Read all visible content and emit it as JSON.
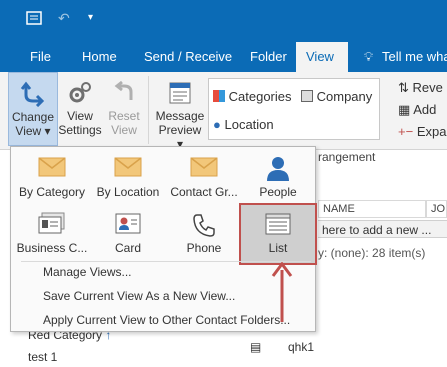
{
  "quick_access": {
    "app_icon": "outlook-icon",
    "undo_icon": "undo-icon",
    "customize_icon": "customize-qat-icon"
  },
  "tabs": [
    {
      "label": "File"
    },
    {
      "label": "Home"
    },
    {
      "label": "Send / Receive"
    },
    {
      "label": "Folder"
    },
    {
      "label": "View"
    },
    {
      "label": "Tell me wha"
    }
  ],
  "ribbon": {
    "change_view": "Change",
    "change_view_2": "View",
    "view_settings": "View",
    "view_settings_2": "Settings",
    "reset_view": "Reset",
    "reset_view_2": "View",
    "message_preview": "Message",
    "message_preview_2": "Preview",
    "categories": "Categories",
    "company": "Company",
    "location": "Location",
    "reverse": "Reve",
    "add": "Add",
    "expand": "Expa"
  },
  "background": {
    "arrangement_label": "rangement",
    "name_header": "NAME",
    "jo_header": "JO",
    "add_new_row": "here to add a new ...",
    "filter_text": "y: (none): 28 item(s)",
    "red_category": "Red Category",
    "test1": "test 1",
    "qhk1": "qhk1"
  },
  "popup": {
    "views": [
      {
        "label": "By Category",
        "icon": "envelope-icon"
      },
      {
        "label": "By Location",
        "icon": "envelope-icon"
      },
      {
        "label": "Contact Gr...",
        "icon": "envelope-icon"
      },
      {
        "label": "People",
        "icon": "person-icon"
      },
      {
        "label": "Business C...",
        "icon": "business-card-icon"
      },
      {
        "label": "Card",
        "icon": "contact-card-icon"
      },
      {
        "label": "Phone",
        "icon": "phone-icon"
      },
      {
        "label": "List",
        "icon": "list-icon"
      }
    ],
    "menu": [
      {
        "label": "Manage Views..."
      },
      {
        "label": "Save Current View As a New View..."
      },
      {
        "label": "Apply Current View to Other Contact Folders..."
      }
    ]
  },
  "colors": {
    "accent": "#0b6bb6",
    "annotation": "#c0504d",
    "selected_bg": "#cfcfcf",
    "ribbon_bg": "#f3f3f3"
  }
}
